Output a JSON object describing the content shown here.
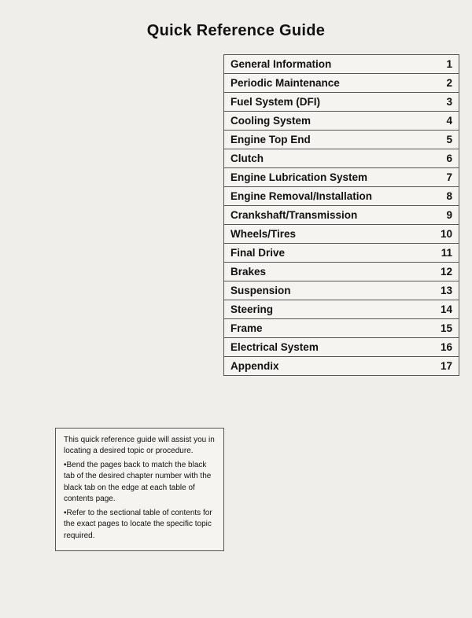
{
  "page": {
    "title": "Quick Reference Guide"
  },
  "toc": {
    "items": [
      {
        "title": "General Information",
        "number": "1"
      },
      {
        "title": "Periodic Maintenance",
        "number": "2"
      },
      {
        "title": "Fuel System (DFI)",
        "number": "3"
      },
      {
        "title": "Cooling System",
        "number": "4"
      },
      {
        "title": "Engine Top End",
        "number": "5"
      },
      {
        "title": "Clutch",
        "number": "6"
      },
      {
        "title": "Engine Lubrication System",
        "number": "7"
      },
      {
        "title": "Engine Removal/Installation",
        "number": "8"
      },
      {
        "title": "Crankshaft/Transmission",
        "number": "9"
      },
      {
        "title": "Wheels/Tires",
        "number": "10"
      },
      {
        "title": "Final Drive",
        "number": "11"
      },
      {
        "title": "Brakes",
        "number": "12"
      },
      {
        "title": "Suspension",
        "number": "13"
      },
      {
        "title": "Steering",
        "number": "14"
      },
      {
        "title": "Frame",
        "number": "15"
      },
      {
        "title": "Electrical System",
        "number": "16"
      },
      {
        "title": "Appendix",
        "number": "17"
      }
    ]
  },
  "note": {
    "lines": [
      "This quick reference guide will assist you in locating a desired topic or procedure.",
      "•Bend the pages back to match the black tab of the desired chapter number with the black tab on the edge at each table of contents page.",
      "•Refer to the sectional table of contents for the exact pages to locate the specific topic required."
    ]
  }
}
